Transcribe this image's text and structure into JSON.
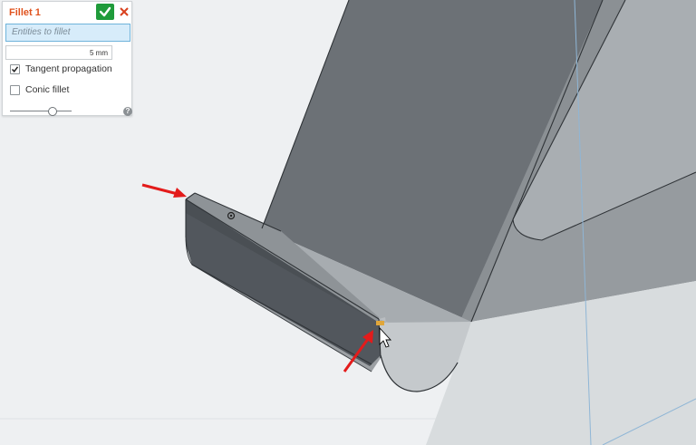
{
  "fillet_panel": {
    "title": "Fillet 1",
    "entities_placeholder": "Entities to fillet",
    "radius_value": "5 mm",
    "tangent_propagation": {
      "label": "Tangent propagation",
      "checked": true
    },
    "conic_fillet": {
      "label": "Conic fillet",
      "checked": false
    },
    "help_icon": "?",
    "accept_icon": "checkmark-icon",
    "cancel_icon": "close-icon"
  },
  "colors": {
    "title": "#e0531f",
    "accept_button": "#1f9b3a",
    "cancel_icon": "#d9421f",
    "entities_field_bg": "#d7ecfa",
    "arrow": "#e31b1b",
    "edge_highlight": "#e0a63a"
  }
}
